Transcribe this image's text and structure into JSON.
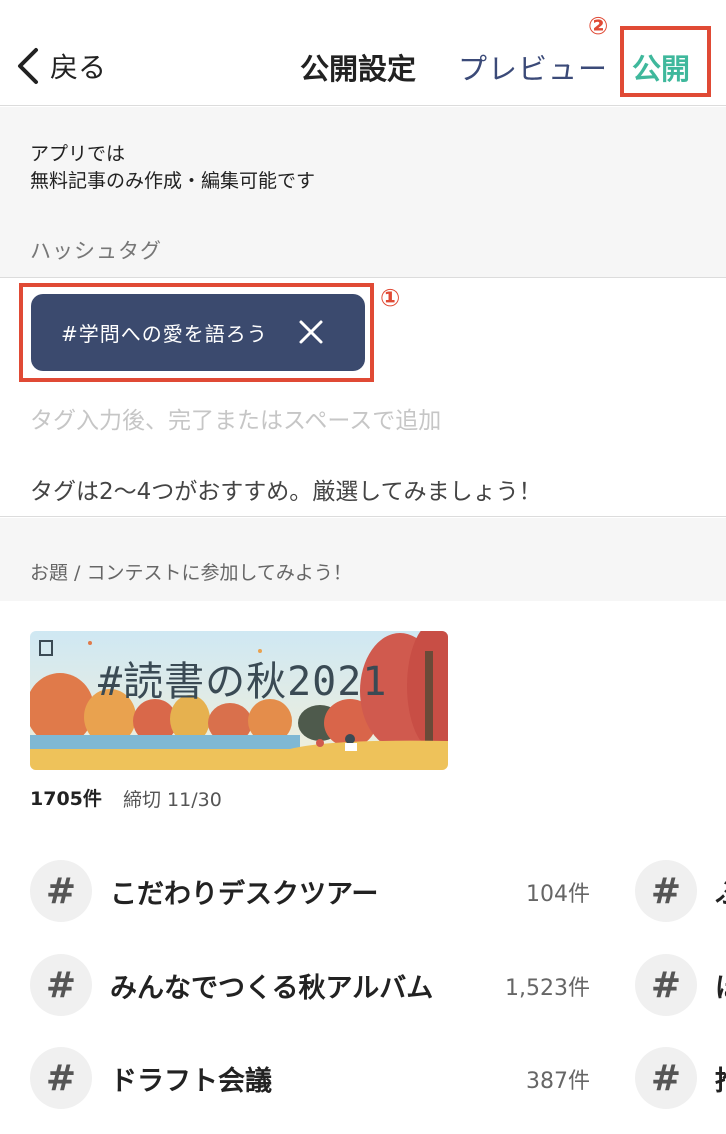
{
  "header": {
    "back_label": "戻る",
    "title": "公開設定",
    "preview_label": "プレビュー",
    "publish_label": "公開",
    "annotation_2": "②"
  },
  "info": {
    "notice_line1": "アプリでは",
    "notice_line2": "無料記事のみ作成・編集可能です",
    "hashtag_label": "ハッシュタグ"
  },
  "tags": {
    "chip_label": "#学問への愛を語ろう",
    "annotation_1": "①",
    "input_placeholder": "タグ入力後、完了またはスペースで追加",
    "hint": "タグは2〜4つがおすすめ。厳選してみましょう！"
  },
  "contest": {
    "section_label": "お題 / コンテストに参加してみよう！",
    "banner_title": "#読書の秋2021",
    "count": "1705件",
    "deadline": "締切 11/30"
  },
  "hashtag_list": [
    {
      "name": "こだわりデスクツアー",
      "count": "104件"
    },
    {
      "name": "みんなでつくる秋アルバム",
      "count": "1,523件"
    },
    {
      "name": "ドラフト会議",
      "count": "387件"
    }
  ],
  "hashtag_list_2": [
    {
      "name": "ふ"
    },
    {
      "name": "ほ"
    },
    {
      "name": "推"
    }
  ],
  "colors": {
    "accent": "#3fb89c",
    "chip_bg": "#3b4a6e",
    "annotation": "#e04a35",
    "preview": "#3b4a78"
  }
}
